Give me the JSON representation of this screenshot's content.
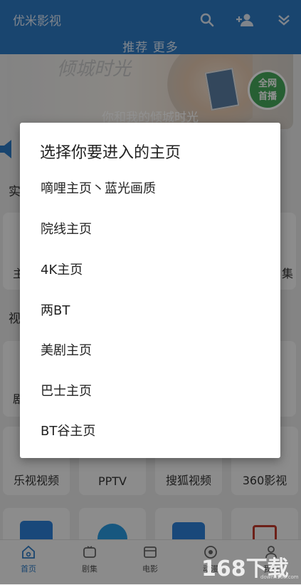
{
  "app": {
    "title": "优米影视",
    "nav_text": "推荐 更多"
  },
  "banner": {
    "caption": "你和我的倾城时光",
    "script_text": "倾城时光",
    "badge_line1": "全网",
    "badge_line2": "首播"
  },
  "background": {
    "section1_char": "实",
    "section2_char": "视",
    "row1_left_char": "主",
    "row1_right_char": "集",
    "row2_left_char": "剧",
    "apps": [
      "乐视视频",
      "PPTV",
      "搜狐视频",
      "360影视"
    ]
  },
  "dialog": {
    "title": "选择你要进入的主页",
    "options": [
      "嘀哩主页丶蓝光画质",
      "院线主页",
      "4K主页",
      "两BT",
      "美剧主页",
      "巴士主页",
      "BT谷主页"
    ]
  },
  "bottom_nav": [
    {
      "label": "首页",
      "icon": "home-icon",
      "active": true
    },
    {
      "label": "剧集",
      "icon": "tv-icon",
      "active": false
    },
    {
      "label": "电影",
      "icon": "film-icon",
      "active": false
    },
    {
      "label": "动漫",
      "icon": "anime-icon",
      "active": false
    },
    {
      "label": "我的",
      "icon": "user-icon",
      "active": false
    }
  ],
  "watermark": {
    "text": "168下载",
    "url": "down.l168.com"
  },
  "colors": {
    "topbar": "#2d79c4",
    "accent": "#2d79c4",
    "overlay": "rgba(0,0,0,0.43)"
  }
}
